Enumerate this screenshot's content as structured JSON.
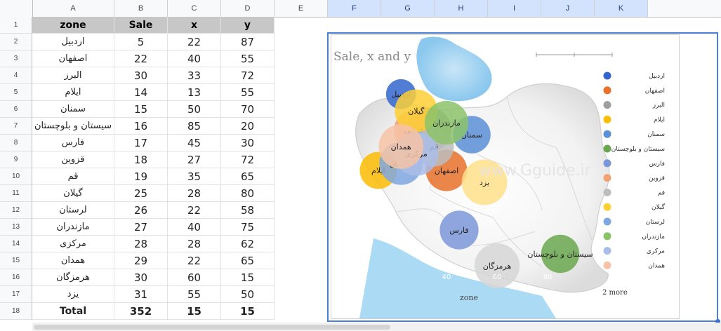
{
  "columns": [
    "A",
    "B",
    "C",
    "D",
    "E",
    "F",
    "G",
    "H",
    "I",
    "J",
    "K"
  ],
  "selected_columns": [
    "F",
    "G",
    "H",
    "I",
    "J",
    "K"
  ],
  "rows": [
    "1",
    "2",
    "3",
    "4",
    "5",
    "6",
    "7",
    "8",
    "9",
    "10",
    "11",
    "12",
    "13",
    "14",
    "15",
    "16",
    "17",
    "18"
  ],
  "table": {
    "headers": [
      "zone",
      "Sale",
      "x",
      "y"
    ],
    "rows": [
      [
        "اردبیل",
        "5",
        "22",
        "87"
      ],
      [
        "اصفهان",
        "22",
        "40",
        "55"
      ],
      [
        "البرز",
        "30",
        "33",
        "72"
      ],
      [
        "ایلام",
        "14",
        "13",
        "55"
      ],
      [
        "سمنان",
        "15",
        "50",
        "70"
      ],
      [
        "سیستان و بلوچستان",
        "16",
        "85",
        "20"
      ],
      [
        "فارس",
        "17",
        "45",
        "30"
      ],
      [
        "قزوین",
        "18",
        "27",
        "72"
      ],
      [
        "قم",
        "19",
        "35",
        "65"
      ],
      [
        "گیلان",
        "25",
        "28",
        "80"
      ],
      [
        "لرستان",
        "26",
        "22",
        "58"
      ],
      [
        "مازندران",
        "27",
        "40",
        "75"
      ],
      [
        "مرکزی",
        "28",
        "28",
        "62"
      ],
      [
        "همدان",
        "29",
        "22",
        "65"
      ],
      [
        "هرمزگان",
        "30",
        "60",
        "15"
      ],
      [
        "یزد",
        "31",
        "55",
        "50"
      ]
    ],
    "total": [
      "Total",
      "352",
      "15",
      "15"
    ]
  },
  "chart_data": {
    "type": "scatter",
    "title": "Sale, x and y",
    "xlabel": "zone",
    "x_ticks": [
      "40",
      "60",
      "80"
    ],
    "xlim": [
      0,
      100
    ],
    "ylim": [
      0,
      100
    ],
    "watermark": "www.Gguide.ir",
    "legend_position": "right",
    "legend_more": "2 more",
    "series": [
      {
        "name": "اردبیل",
        "x": 22,
        "y": 87,
        "size": 5,
        "color": "#3366cc"
      },
      {
        "name": "اصفهان",
        "x": 40,
        "y": 55,
        "size": 22,
        "color": "#e8712b"
      },
      {
        "name": "البرز",
        "x": 33,
        "y": 72,
        "size": 30,
        "color": "#9e9e9e"
      },
      {
        "name": "ایلام",
        "x": 13,
        "y": 55,
        "size": 14,
        "color": "#fbbc04"
      },
      {
        "name": "سمنان",
        "x": 50,
        "y": 70,
        "size": 15,
        "color": "#5b8fd6"
      },
      {
        "name": "سیستان و بلوچستان",
        "x": 85,
        "y": 20,
        "size": 16,
        "color": "#6aa84f"
      },
      {
        "name": "فارس",
        "x": 45,
        "y": 30,
        "size": 17,
        "color": "#7b97d9"
      },
      {
        "name": "قزوین",
        "x": 27,
        "y": 72,
        "size": 18,
        "color": "#f2a074"
      },
      {
        "name": "قم",
        "x": 35,
        "y": 65,
        "size": 19,
        "color": "#bdbdbd"
      },
      {
        "name": "گیلان",
        "x": 28,
        "y": 80,
        "size": 25,
        "color": "#fdd036"
      },
      {
        "name": "لرستان",
        "x": 22,
        "y": 58,
        "size": 26,
        "color": "#7fa7e0"
      },
      {
        "name": "مازندران",
        "x": 40,
        "y": 75,
        "size": 27,
        "color": "#8cc36a"
      },
      {
        "name": "مرکزی",
        "x": 28,
        "y": 62,
        "size": 28,
        "color": "#a9bde8"
      },
      {
        "name": "همدان",
        "x": 22,
        "y": 65,
        "size": 29,
        "color": "#f6c3a6"
      },
      {
        "name": "هرمزگان",
        "x": 60,
        "y": 15,
        "size": 30,
        "color": "#d6d6d6"
      },
      {
        "name": "یزد",
        "x": 55,
        "y": 50,
        "size": 31,
        "color": "#ffe08a"
      }
    ]
  }
}
